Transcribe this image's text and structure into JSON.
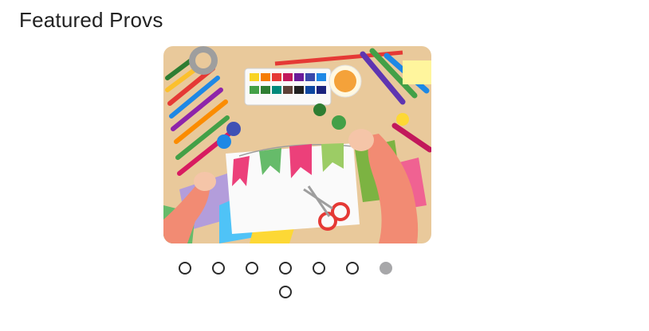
{
  "section": {
    "title": "Featured Provs"
  },
  "carousel": {
    "slide_image": "arts-and-crafts-table-photo",
    "dots": [
      {
        "active": false
      },
      {
        "active": false
      },
      {
        "active": false
      },
      {
        "active": false
      },
      {
        "active": false
      },
      {
        "active": false
      },
      {
        "active": true
      },
      {
        "active": false
      }
    ]
  },
  "colors": {
    "title_text": "#222222",
    "dot_border": "#2b2b2b",
    "dot_active": "#a7a7a9",
    "background": "#ffffff"
  }
}
